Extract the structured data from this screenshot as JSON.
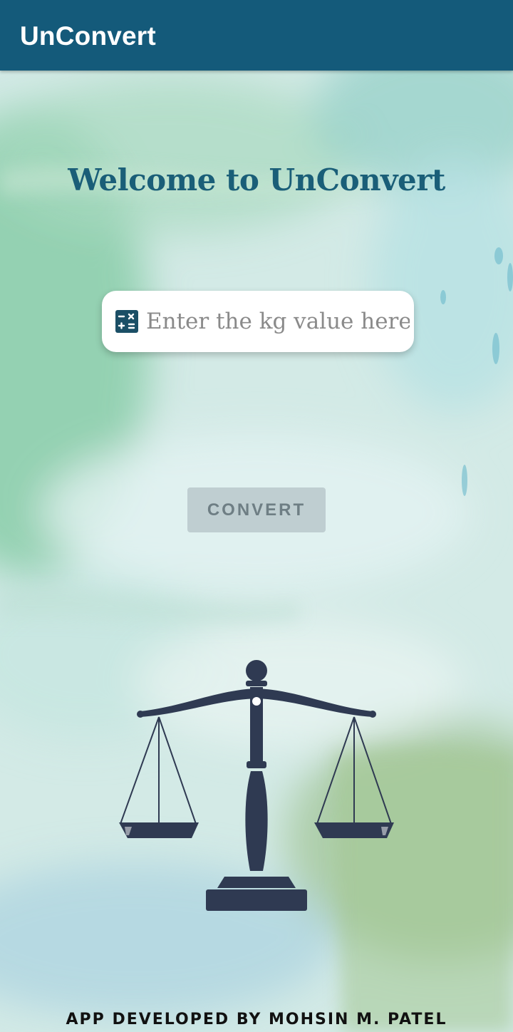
{
  "app": {
    "title": "UnConvert"
  },
  "main": {
    "welcome": "Welcome to UnConvert",
    "input": {
      "placeholder": "Enter the kg value here",
      "value": ""
    },
    "convert_label": "CONVERT",
    "footer": "APP DEVELOPED BY MOHSIN M. PATEL"
  },
  "icons": {
    "input_icon": "calculator-icon",
    "illustration": "balance-scale-icon"
  },
  "colors": {
    "appbar": "#145a7a",
    "accent": "#1a5e78",
    "scale": "#2f3a52"
  }
}
